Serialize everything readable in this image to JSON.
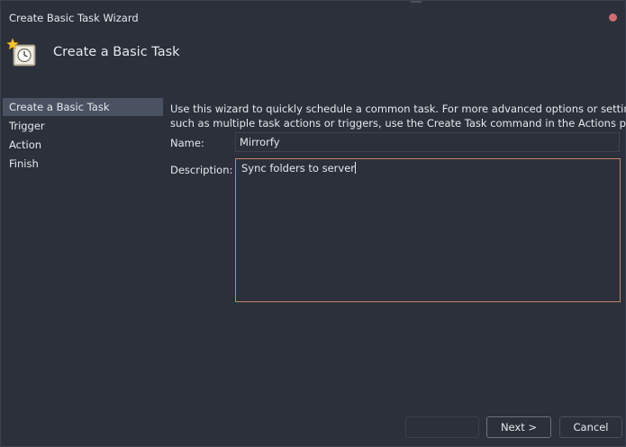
{
  "window": {
    "title": "Create Basic Task Wizard"
  },
  "header": {
    "title": "Create a Basic Task",
    "icon": "task-scheduler-clock-icon"
  },
  "steps": [
    {
      "label": "Create a Basic Task",
      "active": true
    },
    {
      "label": "Trigger",
      "active": false
    },
    {
      "label": "Action",
      "active": false
    },
    {
      "label": "Finish",
      "active": false
    }
  ],
  "intro": {
    "line1": "Use this wizard to quickly schedule a common task.  For more advanced options or settings",
    "line2": "such as multiple task actions or triggers, use the Create Task command in the Actions pane."
  },
  "form": {
    "name_label": "Name:",
    "name_value": "Mirrorfy",
    "description_label": "Description:",
    "description_value": "Sync folders to server"
  },
  "buttons": {
    "back_label": "",
    "next_label": "Next >",
    "cancel_label": "Cancel"
  },
  "colors": {
    "background": "#2b303b",
    "active_step": "#4a5262",
    "focus_border": "#c7836d",
    "close_button": "#d36b74"
  }
}
